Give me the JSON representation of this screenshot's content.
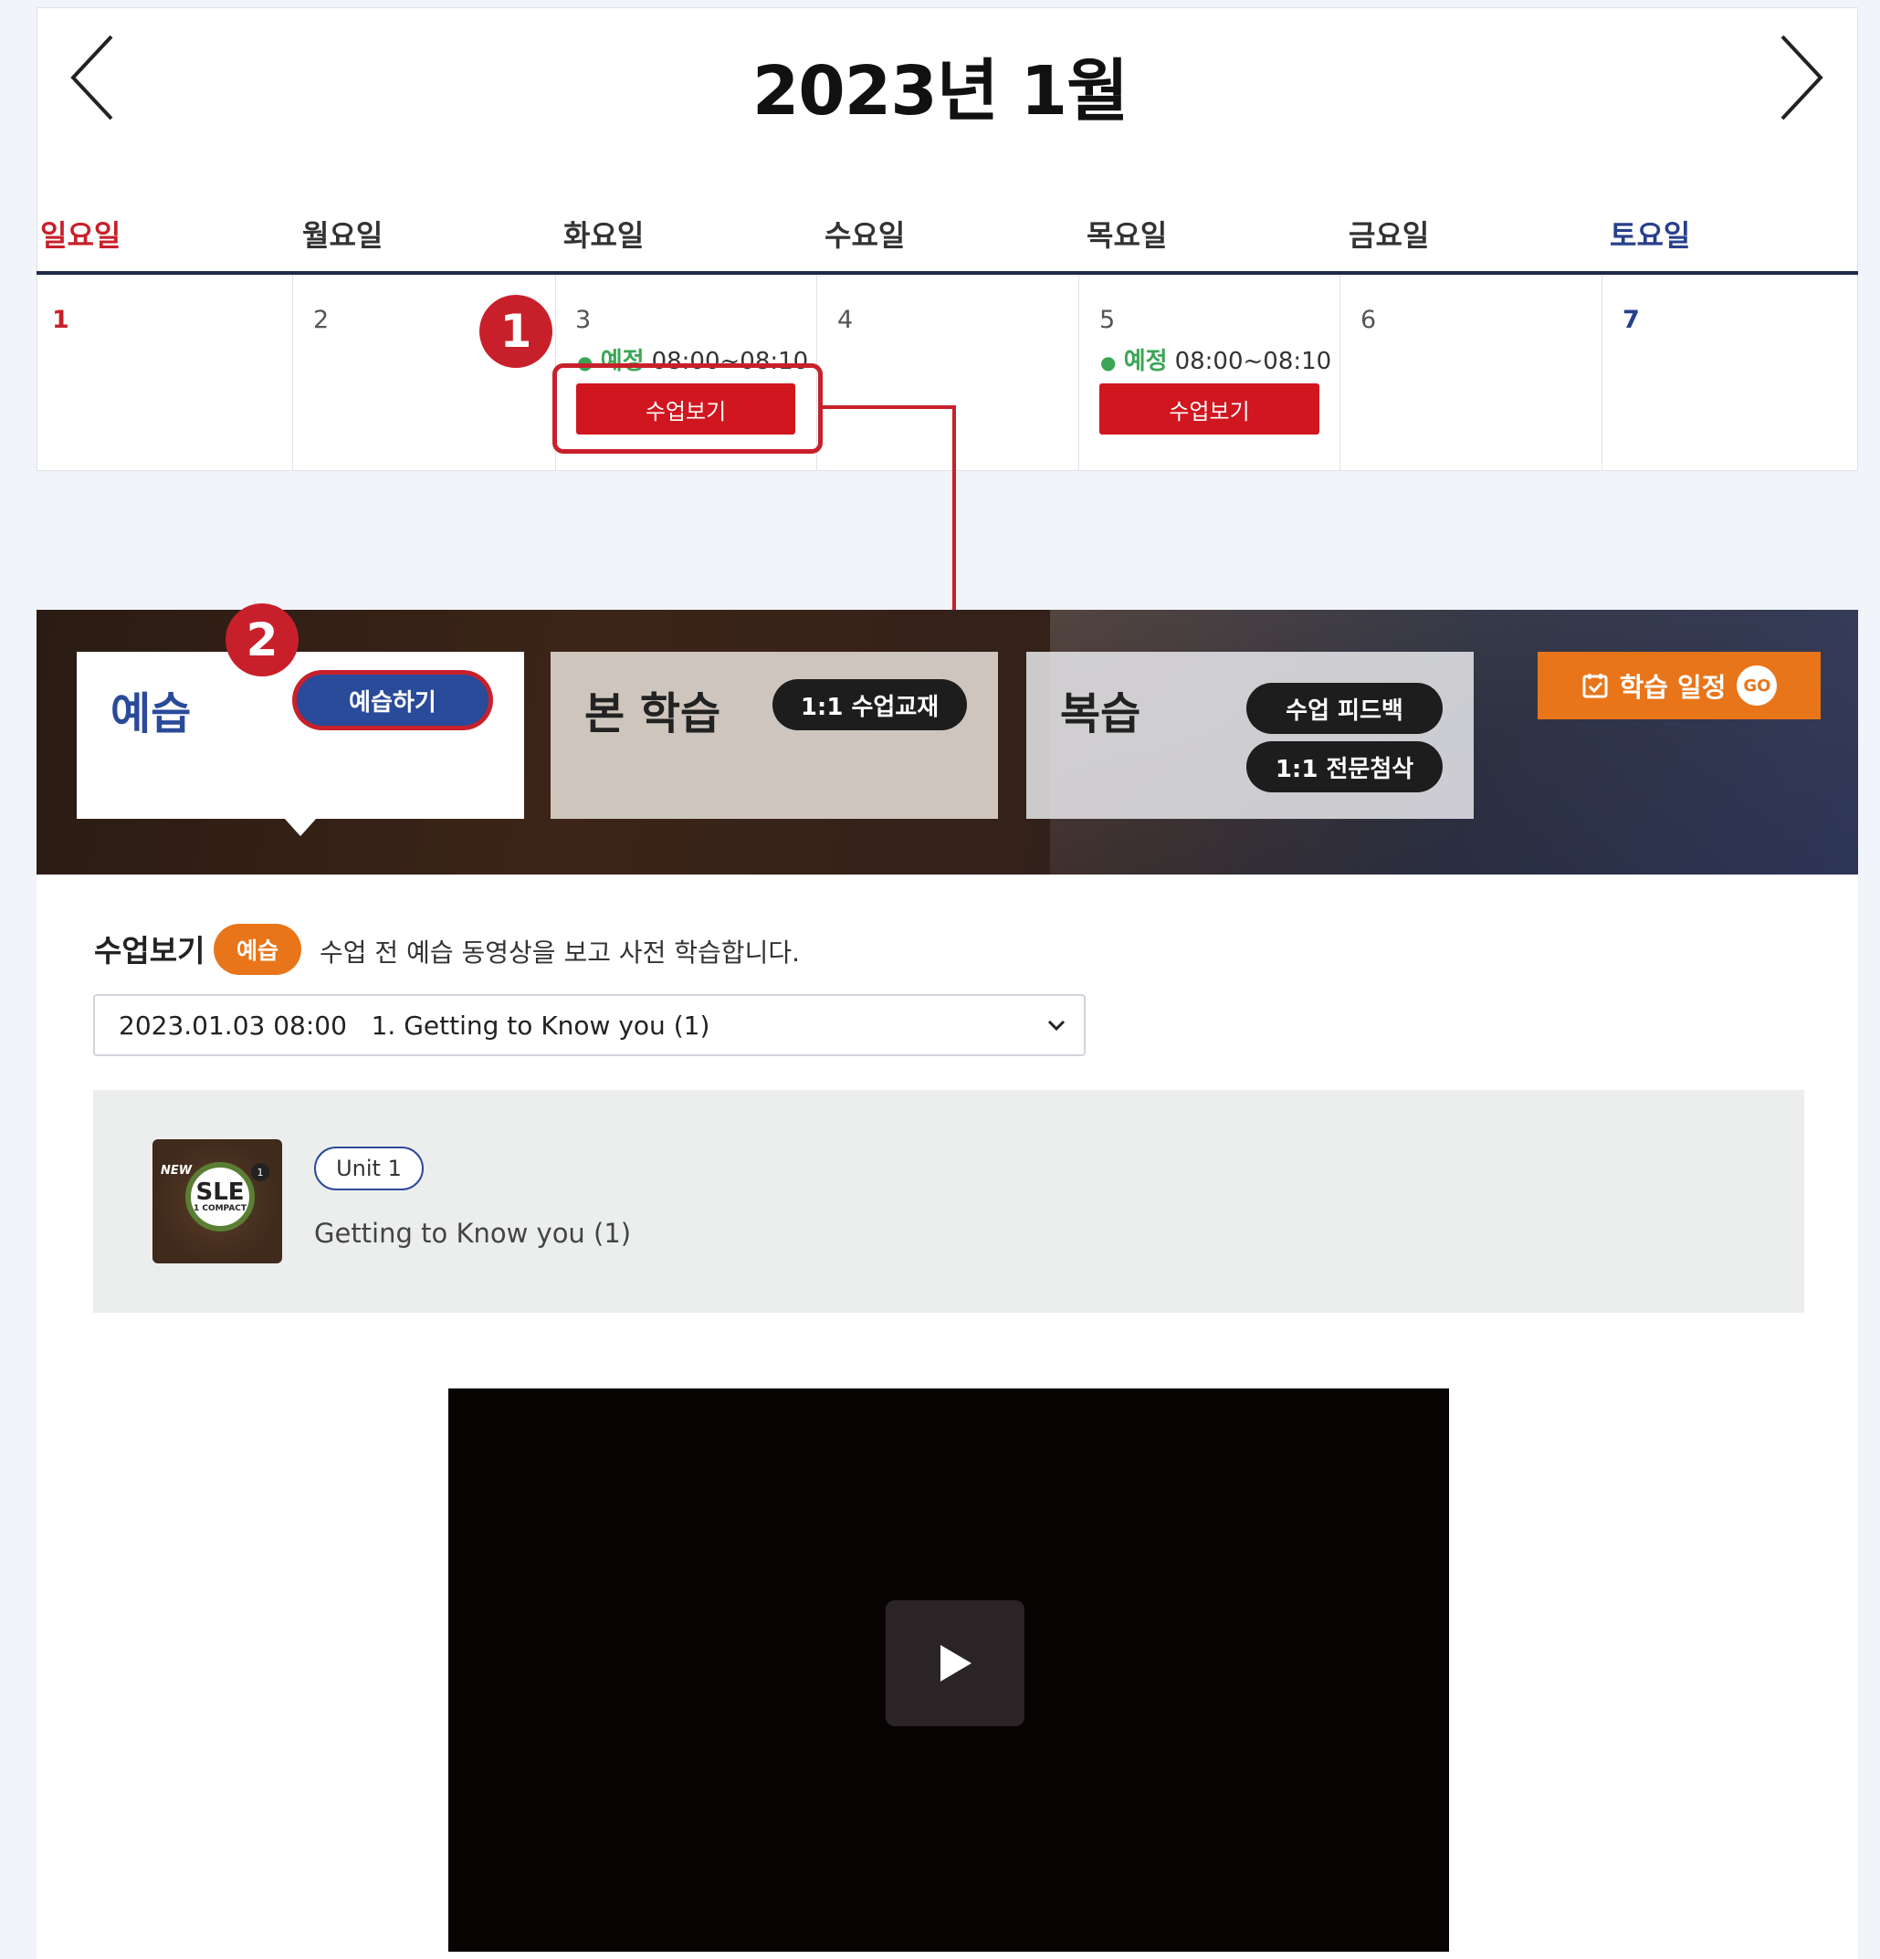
{
  "calendar": {
    "month_title": "2023년 1월",
    "prev_icon": "chevron-left-icon",
    "next_icon": "chevron-right-icon",
    "weekdays": [
      "일요일",
      "월요일",
      "화요일",
      "수요일",
      "목요일",
      "금요일",
      "토요일"
    ],
    "days": [
      "1",
      "2",
      "3",
      "4",
      "5",
      "6",
      "7"
    ],
    "events": [
      {
        "day": "3",
        "status": "예정",
        "time": "08:00~08:10",
        "button": "수업보기"
      },
      {
        "day": "5",
        "status": "예정",
        "time": "08:00~08:10",
        "button": "수업보기"
      }
    ]
  },
  "steps": {
    "one": "1",
    "two": "2"
  },
  "banner": {
    "tabs": [
      {
        "title": "예습",
        "buttons": [
          "예습하기"
        ]
      },
      {
        "title": "본 학습",
        "buttons": [
          "1:1 수업교재"
        ]
      },
      {
        "title": "복습",
        "buttons": [
          "수업 피드백",
          "1:1 전문첨삭"
        ]
      }
    ],
    "schedule_button": {
      "label": "학습 일정",
      "go": "GO",
      "icon": "calendar-check-icon"
    }
  },
  "content": {
    "section_title": "수업보기",
    "section_tag": "예습",
    "section_desc": "수업 전 예습 동영상을 보고 사전 학습합니다.",
    "select_value": "2023.01.03 08:00   1. Getting to Know you (1)",
    "book": {
      "line1": "SLE",
      "line2": "1 COMPACT",
      "new": "NEW",
      "badge": "1"
    },
    "unit_label": "Unit 1",
    "unit_title": "Getting to Know you (1)",
    "video_icon": "play-icon"
  },
  "colors": {
    "accent_red": "#c8202b",
    "navy": "#1e2a4a",
    "orange": "#e8751a",
    "blue": "#2a4a9a",
    "green": "#3aa655"
  }
}
